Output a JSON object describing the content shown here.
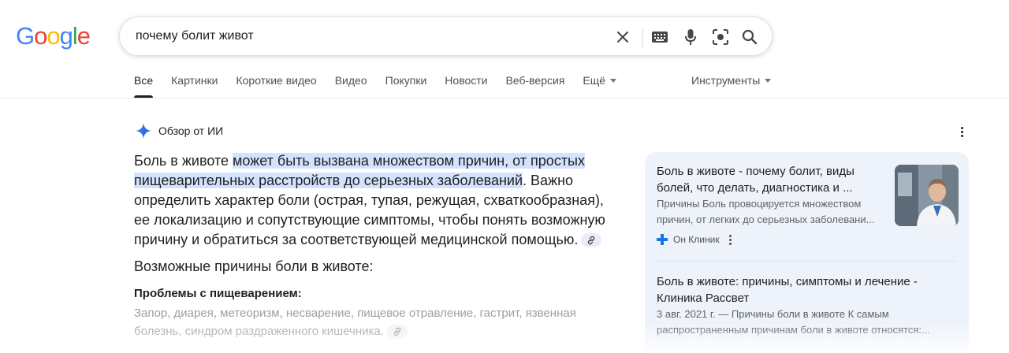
{
  "logo": {
    "letters": [
      "G",
      "o",
      "o",
      "g",
      "l",
      "e"
    ],
    "colors": [
      "#4285f4",
      "#ea4335",
      "#fbbc05",
      "#4285f4",
      "#34a853",
      "#ea4335"
    ]
  },
  "search": {
    "query": "почему болит живот",
    "icons": [
      "clear-icon",
      "keyboard-icon",
      "mic-icon",
      "lens-icon",
      "search-icon"
    ]
  },
  "nav": {
    "tabs": [
      "Все",
      "Картинки",
      "Короткие видео",
      "Видео",
      "Покупки",
      "Новости",
      "Веб-версия"
    ],
    "more": "Ещё",
    "tools": "Инструменты"
  },
  "ai_overview": {
    "title": "Обзор от ИИ",
    "answer_start": "Боль в животе ",
    "answer_highlight": "может быть вызвана множеством причин, от простых пищеварительных расстройств до серьезных заболеваний",
    "answer_end": ". Важно определить характер боли (острая, тупая, режущая, схваткообразная), ее локализацию и сопутствующие симптомы, чтобы понять возможную причину и обратиться за соответствующей медицинской помощью.",
    "subheading": "Возможные причины боли в животе:",
    "section_title": "Проблемы с пищеварением:",
    "section_text": "Запор, диарея, метеоризм, несварение, пищевое отравление, гастрит, язвенная болезнь, синдром раздраженного кишечника."
  },
  "sources": [
    {
      "title": "Боль в животе - почему болит, виды болей, что делать, диагностика и ...",
      "snippet": "Причины Боль провоцируется множеством причин, от легких до серьезных заболевани...",
      "site": "Он Клиник"
    },
    {
      "title": "Боль в животе: причины, симптомы и лечение - Клиника Рассвет",
      "snippet": "3 авг. 2021 г. — Причины боли в животе К самым распространенным причинам боли в животе относятся:..."
    }
  ],
  "colors": {
    "accent": "#1a73e8",
    "highlight": "#d3e3fd",
    "panel": "#eef3fb"
  }
}
